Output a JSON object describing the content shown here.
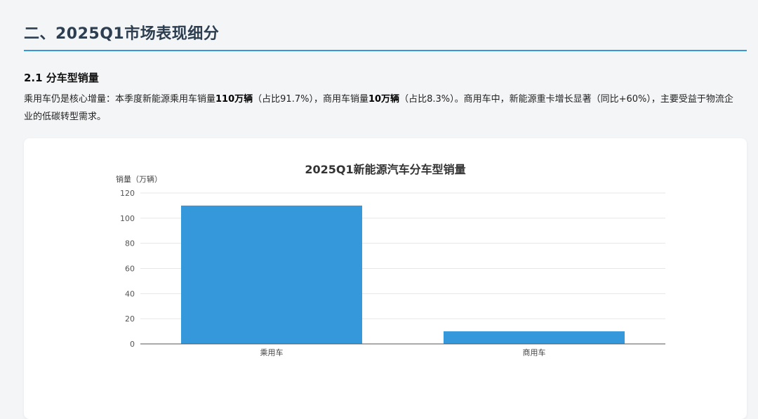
{
  "section": {
    "title": "二、2025Q1市场表现细分"
  },
  "subsection": {
    "title": "2.1 分车型销量"
  },
  "paragraph": {
    "p1": "乘用车仍是核心增量：本季度新能源乘用车销量",
    "b1": "110万辆",
    "p2": "（占比91.7%），商用车销量",
    "b2": "10万辆",
    "p3": "（占比8.3%）。商用车中，新能源重卡增长显著（同比+60%），主要受益于物流企业的低碳转型需求。"
  },
  "colors": {
    "accent": "#3498db",
    "bar": "#3498db"
  },
  "chart_data": {
    "type": "bar",
    "title": "2025Q1新能源汽车分车型销量",
    "xlabel": "",
    "ylabel": "销量（万辆）",
    "categories": [
      "乘用车",
      "商用车"
    ],
    "values": [
      110,
      10
    ],
    "ylim": [
      0,
      120
    ],
    "yticks": [
      0,
      20,
      40,
      60,
      80,
      100,
      120
    ],
    "grid": true,
    "legend": false
  }
}
